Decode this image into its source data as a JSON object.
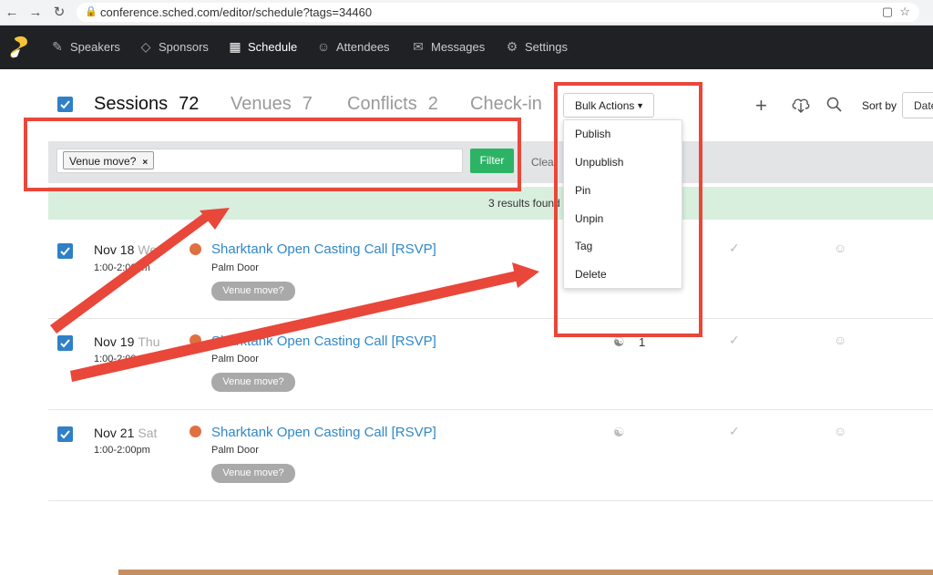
{
  "browser": {
    "url": "conference.sched.com/editor/schedule?tags=34460",
    "back_icon": "←",
    "forward_icon": "→",
    "reload_icon": "↻"
  },
  "nav": {
    "items": [
      {
        "label": "Speakers",
        "icon": "pen-icon",
        "glyph": "✎"
      },
      {
        "label": "Sponsors",
        "icon": "diamond-icon",
        "glyph": "◇"
      },
      {
        "label": "Schedule",
        "icon": "calendar-icon",
        "glyph": "▦"
      },
      {
        "label": "Attendees",
        "icon": "smiley-icon",
        "glyph": "☺"
      },
      {
        "label": "Messages",
        "icon": "chat-icon",
        "glyph": "✉"
      },
      {
        "label": "Settings",
        "icon": "gear-icon",
        "glyph": "⚙"
      }
    ],
    "active": "Schedule"
  },
  "tabs": [
    {
      "label": "Sessions",
      "count": "72"
    },
    {
      "label": "Venues",
      "count": "7"
    },
    {
      "label": "Conflicts",
      "count": "2"
    },
    {
      "label": "Check-in",
      "count": ""
    }
  ],
  "bulk_actions": {
    "label": "Bulk Actions",
    "caret": "▼",
    "items": [
      "Publish",
      "Unpublish",
      "Pin",
      "Unpin",
      "Tag",
      "Delete"
    ]
  },
  "toolbar": {
    "add_icon": "+",
    "search_icon": "⌕",
    "sort_label": "Sort by",
    "sort_value": "Date"
  },
  "filter": {
    "chip_label": "Venue move?",
    "chip_remove": "×",
    "filter_button": "Filter",
    "clear_label": "Clear"
  },
  "results": {
    "text": "3 results found"
  },
  "sessions": [
    {
      "date": "Nov 18",
      "dow": "Wed",
      "time": "1:00-2:00pm",
      "title": "Sharktank Open Casting Call [RSVP]",
      "venue": "Palm Door",
      "tag": "Venue move?",
      "rsvp": ""
    },
    {
      "date": "Nov 19",
      "dow": "Thu",
      "time": "1:00-2:00pm",
      "title": "Sharktank Open Casting Call [RSVP]",
      "venue": "Palm Door",
      "tag": "Venue move?",
      "rsvp": "1"
    },
    {
      "date": "Nov 21",
      "dow": "Sat",
      "time": "1:00-2:00pm",
      "title": "Sharktank Open Casting Call [RSVP]",
      "venue": "Palm Door",
      "tag": "Venue move?",
      "rsvp": ""
    }
  ],
  "colors": {
    "accent_blue": "#2f80c6",
    "link_blue": "#2f88c8",
    "filter_green": "#2db365",
    "results_bg": "#d8efde",
    "annotation_red": "#e8473a",
    "dot_orange": "#e07040"
  }
}
